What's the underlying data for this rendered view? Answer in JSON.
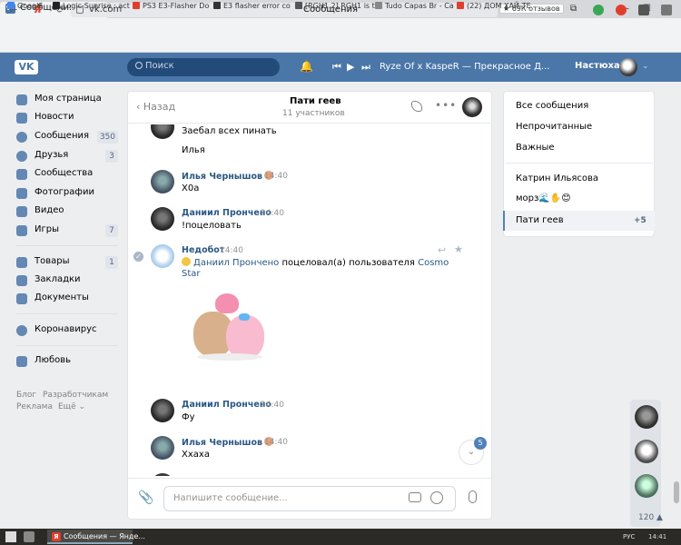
{
  "browser": {
    "tab_title": "Сообщения",
    "tab_close": "✕",
    "new_tab": "+",
    "window_title": "Сообщения",
    "url": "vk.com",
    "reviews": "★ 69К отзывов",
    "window_controls": [
      "⧉",
      "≡",
      "—",
      "☐",
      "✕"
    ],
    "nav": [
      "←",
      "Я",
      "⟳"
    ],
    "bookmarks": [
      "Google",
      "Logic-Sunrise : act",
      "PS3 E3-Flasher Do",
      "E3 flasher error co",
      "[RGH1.2] RGH1 is t",
      "Tudo Capas Br - Ca",
      "(22) ДОМ ХАЙ-ТЕ"
    ]
  },
  "vk_header": {
    "logo": "VK",
    "search_placeholder": "Поиск",
    "track": "Ryze Of x KaspeR — Прекрасное Д...",
    "user_name": "Настюха"
  },
  "left_menu": {
    "items": [
      {
        "label": "Моя страница",
        "count": ""
      },
      {
        "label": "Новости",
        "count": ""
      },
      {
        "label": "Сообщения",
        "count": "350"
      },
      {
        "label": "Друзья",
        "count": "3"
      },
      {
        "label": "Сообщества",
        "count": ""
      },
      {
        "label": "Фотографии",
        "count": ""
      },
      {
        "label": "Видео",
        "count": ""
      },
      {
        "label": "Игры",
        "count": "7"
      },
      {
        "label": "Товары",
        "count": "1"
      },
      {
        "label": "Закладки",
        "count": ""
      },
      {
        "label": "Документы",
        "count": ""
      },
      {
        "label": "Коронавирус",
        "count": ""
      },
      {
        "label": "Любовь",
        "count": ""
      }
    ],
    "footer": [
      "Блог",
      "Разработчикам",
      "Реклама",
      "Ещё ⌄"
    ]
  },
  "chat": {
    "back_label": "Назад",
    "title": "Пати геев",
    "subtitle": "11 участников",
    "messages": [
      {
        "author": "",
        "time": "",
        "text": "Заебал всех пинать"
      },
      {
        "author": "",
        "time": "",
        "text": "Илья"
      },
      {
        "author": "Илья Чернышов",
        "time": "14:40",
        "text": "Х0а"
      },
      {
        "author": "Даниил Прончено",
        "time": "14:40",
        "text": "!поцеловать"
      },
      {
        "author": "Недобот",
        "time": "14:40",
        "text_user1": "Даниил Прончено",
        "text_action": "поцеловал(а) пользователя",
        "text_user2": "Cosmo",
        "text_user2b": "Star"
      },
      {
        "author": "Даниил Прончено",
        "time": "14:40",
        "text": "Фу"
      },
      {
        "author": "Илья Чернышов",
        "time": "14:40",
        "text": "Ххаха"
      }
    ],
    "unread_badge": "5",
    "input_placeholder": "Напишите сообщение..."
  },
  "right_panel": {
    "filters": [
      "Все сообщения",
      "Непрочитанные",
      "Важные"
    ],
    "chats": [
      {
        "label": "Катрин Ильясова",
        "count": ""
      },
      {
        "label": "морз🌊✋😊",
        "count": ""
      },
      {
        "label": "Пати геев",
        "count": "+5"
      }
    ]
  },
  "right_column": {
    "count": "120 ▲"
  },
  "taskbar": {
    "task_title": "Сообщения — Янде...",
    "lang": "РУС",
    "time": "14:41"
  }
}
